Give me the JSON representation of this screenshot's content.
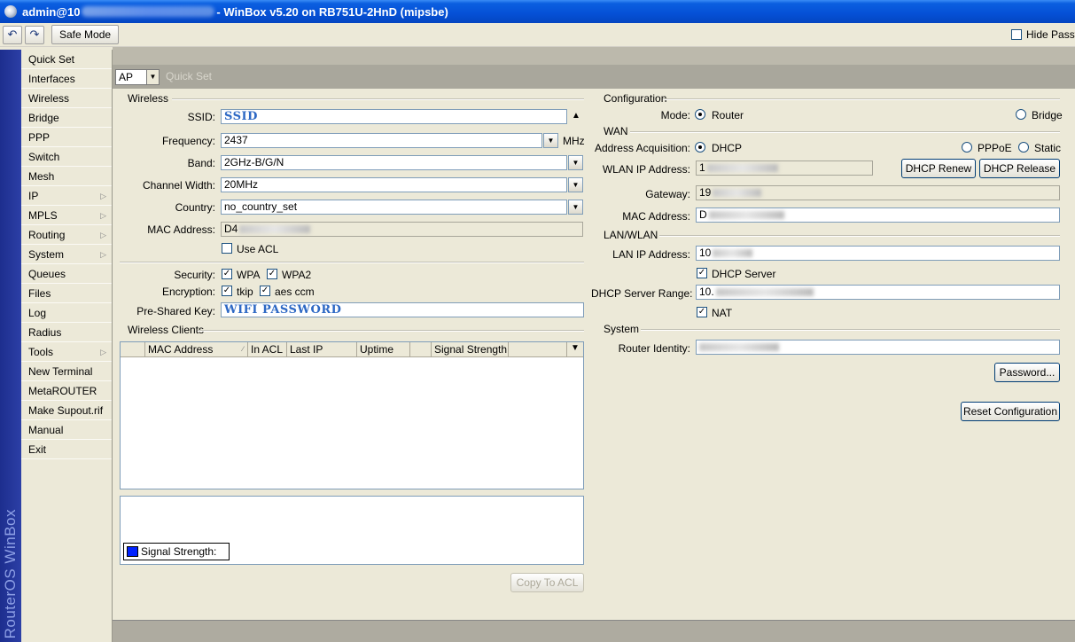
{
  "window": {
    "title_prefix": "admin@10",
    "title_suffix": "- WinBox v5.20 on RB751U-2HnD (mipsbe)"
  },
  "toolbar": {
    "undo_icon": "undo-icon",
    "redo_icon": "redo-icon",
    "safe_mode": "Safe Mode",
    "hide_passwords": "Hide Passw"
  },
  "brand": "RouterOS WinBox",
  "sidebar": {
    "items": [
      {
        "label": "Quick Set",
        "submenu": false
      },
      {
        "label": "Interfaces",
        "submenu": false
      },
      {
        "label": "Wireless",
        "submenu": false
      },
      {
        "label": "Bridge",
        "submenu": false
      },
      {
        "label": "PPP",
        "submenu": false
      },
      {
        "label": "Switch",
        "submenu": false
      },
      {
        "label": "Mesh",
        "submenu": false
      },
      {
        "label": "IP",
        "submenu": true
      },
      {
        "label": "MPLS",
        "submenu": true
      },
      {
        "label": "Routing",
        "submenu": true
      },
      {
        "label": "System",
        "submenu": true
      },
      {
        "label": "Queues",
        "submenu": false
      },
      {
        "label": "Files",
        "submenu": false
      },
      {
        "label": "Log",
        "submenu": false
      },
      {
        "label": "Radius",
        "submenu": false
      },
      {
        "label": "Tools",
        "submenu": true
      },
      {
        "label": "New Terminal",
        "submenu": false
      },
      {
        "label": "MetaROUTER",
        "submenu": false
      },
      {
        "label": "Make Supout.rif",
        "submenu": false
      },
      {
        "label": "Manual",
        "submenu": false
      },
      {
        "label": "Exit",
        "submenu": false
      }
    ]
  },
  "quickset": {
    "mode_select": "AP",
    "title": "Quick Set"
  },
  "wireless": {
    "section": "Wireless",
    "ssid_label": "SSID:",
    "ssid": "SSID",
    "frequency_label": "Frequency:",
    "frequency": "2437",
    "frequency_unit": "MHz",
    "band_label": "Band:",
    "band": "2GHz-B/G/N",
    "channel_width_label": "Channel Width:",
    "channel_width": "20MHz",
    "country_label": "Country:",
    "country": "no_country_set",
    "mac_label": "MAC Address:",
    "mac": "D4",
    "use_acl": "Use ACL",
    "security_label": "Security:",
    "wpa": "WPA",
    "wpa2": "WPA2",
    "encryption_label": "Encryption:",
    "tkip": "tkip",
    "aes": "aes ccm",
    "psk_label": "Pre-Shared Key:",
    "psk": "WIFI PASSWORD"
  },
  "clients": {
    "section": "Wireless Clients",
    "columns": [
      "MAC Address",
      "In ACL",
      "Last IP",
      "Uptime",
      "",
      "Signal Strength"
    ],
    "legend": "Signal Strength:",
    "legend_color": "#0022ff",
    "copy_to_acl": "Copy To ACL"
  },
  "configuration": {
    "section": "Configuration",
    "mode_label": "Mode:",
    "router": "Router",
    "bridge": "Bridge"
  },
  "wan": {
    "section": "WAN",
    "acq_label": "Address Acquisition:",
    "dhcp": "DHCP",
    "pppoe": "PPPoE",
    "static": "Static",
    "wlan_ip_label": "WLAN IP Address:",
    "wlan_ip": "1",
    "dhcp_renew": "DHCP Renew",
    "dhcp_release": "DHCP Release",
    "gateway_label": "Gateway:",
    "gateway": "19",
    "mac_label": "MAC Address:",
    "mac": "D"
  },
  "lan": {
    "section": "LAN/WLAN",
    "lan_ip_label": "LAN IP Address:",
    "lan_ip": "10",
    "dhcp_server": "DHCP Server",
    "range_label": "DHCP Server Range:",
    "range": "10.",
    "nat": "NAT"
  },
  "system": {
    "section": "System",
    "identity_label": "Router Identity:",
    "password": "Password...",
    "reset": "Reset Configuration"
  }
}
